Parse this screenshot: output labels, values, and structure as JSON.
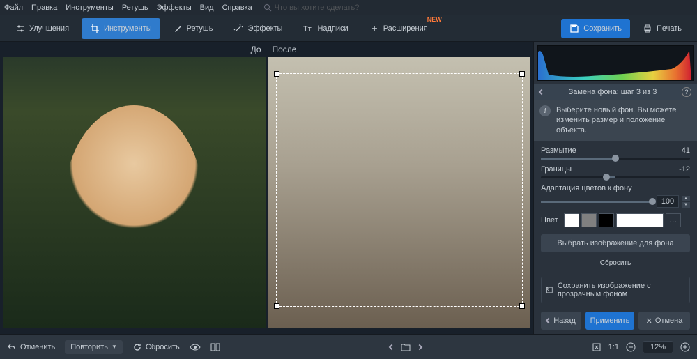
{
  "menu": {
    "file": "Файл",
    "edit": "Правка",
    "tools": "Инструменты",
    "retouch": "Ретушь",
    "effects": "Эффекты",
    "view": "Вид",
    "help": "Справка"
  },
  "search_placeholder": "Что вы хотите сделать?",
  "toolbar": {
    "enhance": "Улучшения",
    "tools": "Инструменты",
    "retouch": "Ретушь",
    "effects": "Эффекты",
    "text": "Надписи",
    "extensions": "Расширения",
    "new_tag": "NEW",
    "save": "Сохранить",
    "print": "Печать"
  },
  "canvas": {
    "before": "До",
    "after": "После"
  },
  "panel": {
    "title": "Замена фона: шаг 3 из 3",
    "info": "Выберите новый фон. Вы можете изменить размер и положение объекта.",
    "blur_label": "Размытие",
    "blur_value": "41",
    "border_label": "Границы",
    "border_value": "-12",
    "adapt_label": "Адаптация цветов к фону",
    "adapt_value": "100",
    "color_label": "Цвет",
    "choose_bg": "Выбрать изображение для фона",
    "reset": "Сбросить",
    "save_transparent": "Сохранить изображение с прозрачным фоном",
    "back": "Назад",
    "apply": "Применить",
    "cancel": "Отмена"
  },
  "swatches": [
    "#ffffff",
    "#808080",
    "#000000",
    "#ffffff"
  ],
  "status": {
    "undo": "Отменить",
    "redo": "Повторить",
    "reset": "Сбросить",
    "ratio": "1:1",
    "zoom": "12%"
  }
}
